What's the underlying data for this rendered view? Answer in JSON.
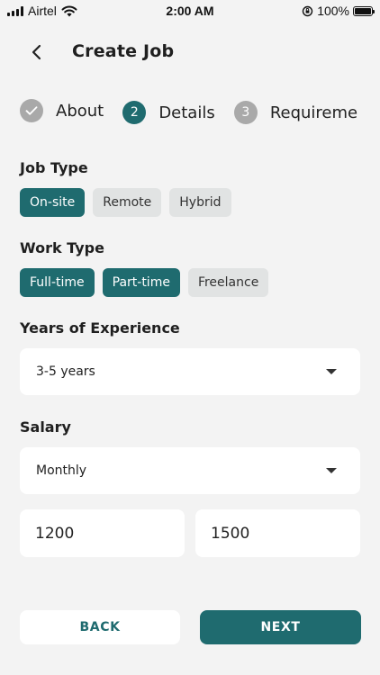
{
  "status_bar": {
    "carrier": "Airtel",
    "time": "2:00 AM",
    "battery": "100%"
  },
  "header": {
    "title": "Create Job"
  },
  "stepper": {
    "steps": [
      {
        "number": "1",
        "label": "About",
        "state": "done"
      },
      {
        "number": "2",
        "label": "Details",
        "state": "active"
      },
      {
        "number": "3",
        "label": "Requireme",
        "state": "pending"
      }
    ]
  },
  "job_type": {
    "label": "Job Type",
    "options": [
      {
        "label": "On-site",
        "selected": true
      },
      {
        "label": "Remote",
        "selected": false
      },
      {
        "label": "Hybrid",
        "selected": false
      }
    ]
  },
  "work_type": {
    "label": "Work Type",
    "options": [
      {
        "label": "Full-time",
        "selected": true
      },
      {
        "label": "Part-time",
        "selected": true
      },
      {
        "label": "Freelance",
        "selected": false
      }
    ]
  },
  "experience": {
    "label": "Years of Experience",
    "value": "3-5 years"
  },
  "salary": {
    "label": "Salary",
    "period": "Monthly",
    "min": "1200",
    "max": "1500"
  },
  "actions": {
    "back_label": "BACK",
    "next_label": "NEXT"
  },
  "colors": {
    "accent": "#1f6b6f",
    "chip_inactive": "#e1e3e3",
    "step_inactive": "#a9a9a9",
    "background": "#f3f3f3"
  },
  "icons": {
    "back": "arrow-left-icon",
    "dropdown": "caret-down-icon",
    "check": "check-icon"
  }
}
